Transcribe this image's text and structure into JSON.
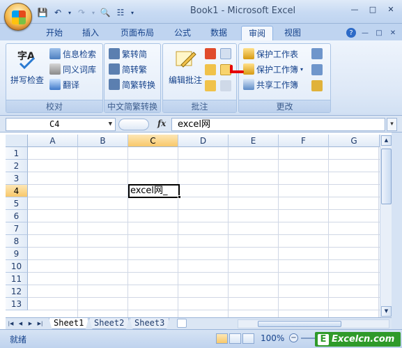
{
  "window": {
    "title": "Book1 - Microsoft Excel"
  },
  "qat": {
    "icons": [
      "save-icon",
      "undo-icon",
      "redo-icon",
      "print-preview-icon",
      "customize-icon"
    ]
  },
  "tabs": [
    {
      "label": "开始"
    },
    {
      "label": "插入"
    },
    {
      "label": "页面布局"
    },
    {
      "label": "公式"
    },
    {
      "label": "数据"
    },
    {
      "label": "审阅"
    },
    {
      "label": "视图"
    }
  ],
  "active_tab": "审阅",
  "ribbon": {
    "proofing": {
      "label": "校对",
      "spell_check": "拼写检查",
      "research": "信息检索",
      "thesaurus": "同义词库",
      "translate": "翻译"
    },
    "chinese_conversion": {
      "label": "中文简繁转换",
      "to_simplified": "繁转简",
      "to_traditional": "简转繁",
      "conversion": "简繁转换"
    },
    "comments": {
      "label": "批注",
      "edit_comment": "编辑批注"
    },
    "changes": {
      "label": "更改",
      "protect_sheet": "保护工作表",
      "protect_workbook": "保护工作簿",
      "share_workbook": "共享工作簿"
    }
  },
  "formula_bar": {
    "name_box": "C4",
    "fx_label": "fx",
    "content": "excel网"
  },
  "grid": {
    "columns": [
      "A",
      "B",
      "C",
      "D",
      "E",
      "F",
      "G"
    ],
    "rows": [
      "1",
      "2",
      "3",
      "4",
      "5",
      "6",
      "7",
      "8",
      "9",
      "10",
      "11",
      "12",
      "13"
    ],
    "selected_column": "C",
    "selected_row": "4",
    "active_cell_text": "excel网_"
  },
  "sheets": [
    "Sheet1",
    "Sheet2",
    "Sheet3"
  ],
  "active_sheet": "Sheet1",
  "status": {
    "text": "就绪",
    "zoom": "100%",
    "zoom_minus": "−"
  },
  "brand": {
    "text": "Excelcn.com",
    "letter": "E"
  },
  "colors": {
    "ribbon_blue": "#15428b",
    "selection": "#f8c86a",
    "brand_green": "#2f9a2a"
  }
}
